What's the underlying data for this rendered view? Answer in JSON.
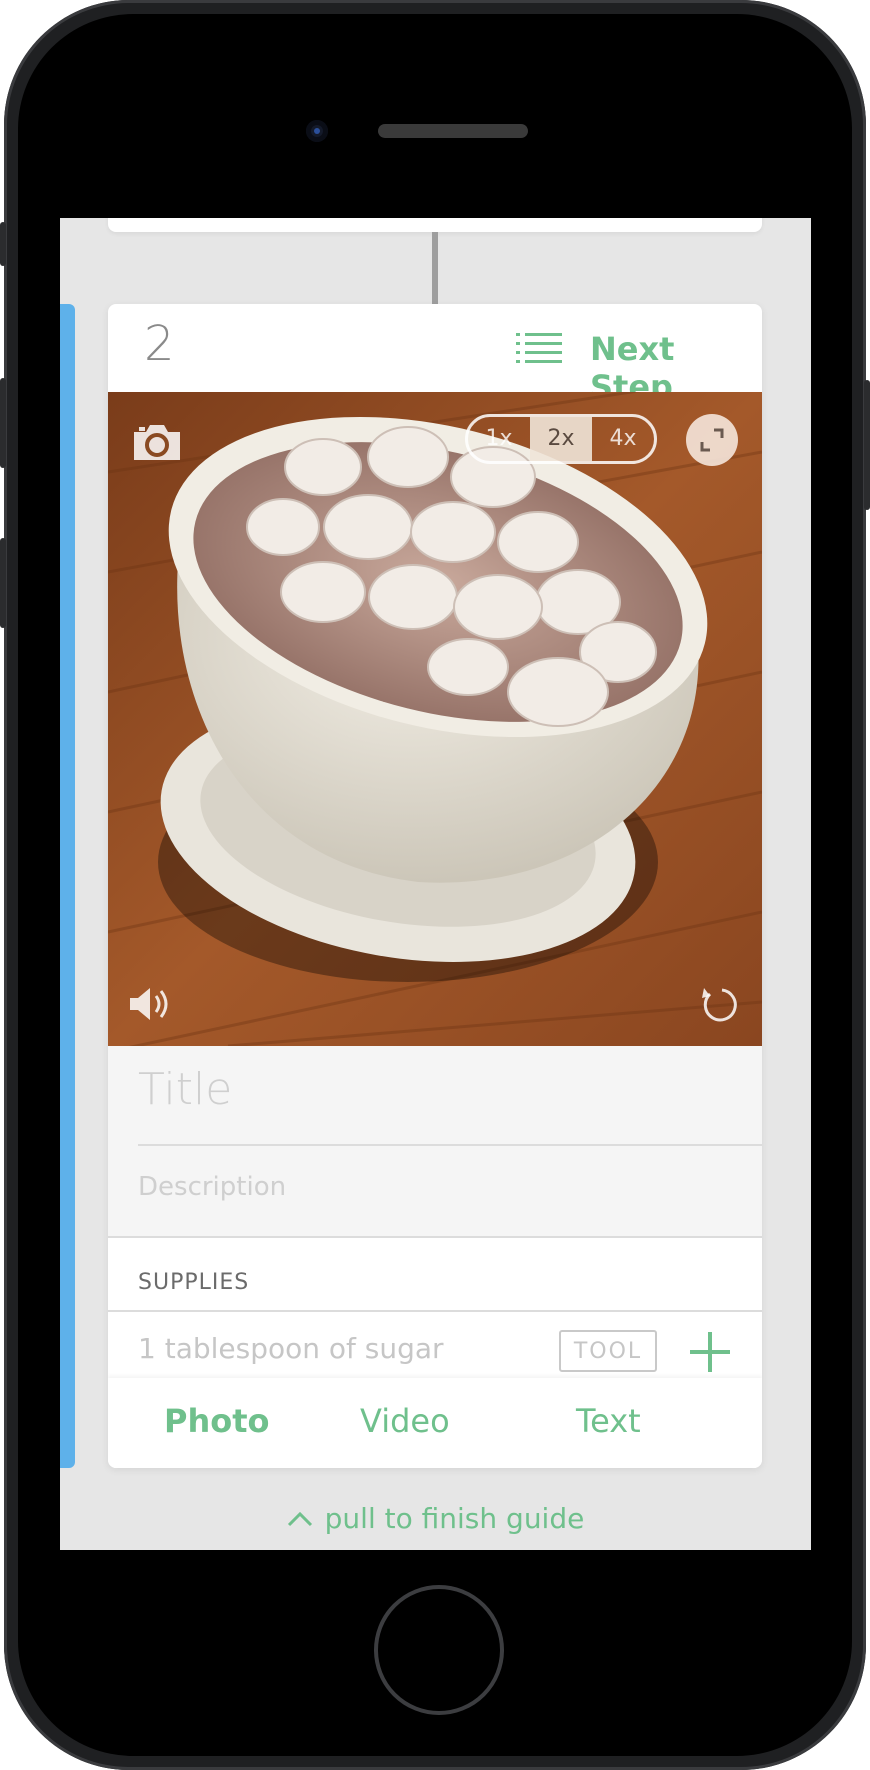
{
  "step": {
    "number": "2",
    "next_label": "Next Step"
  },
  "media": {
    "zoom_options": [
      "1x",
      "2x",
      "4x"
    ],
    "active_zoom": "2x"
  },
  "fields": {
    "title_placeholder": "Title",
    "description_placeholder": "Description"
  },
  "supplies": {
    "heading": "SUPPLIES",
    "items": [
      {
        "text": "1 tablespoon of sugar",
        "badge": "TOOL"
      }
    ]
  },
  "tabs": [
    {
      "label": "Photo",
      "active": true
    },
    {
      "label": "Video",
      "active": false
    },
    {
      "label": "Text",
      "active": false
    }
  ],
  "pull_hint": "pull to finish guide",
  "icons": {
    "list": "list-icon",
    "camera": "camera-icon",
    "expand": "expand-icon",
    "sound": "sound-icon",
    "rotate": "rotate-icon",
    "add": "plus-icon",
    "pull": "chevron-up-icon"
  },
  "colors": {
    "accent_green": "#6fc08c",
    "accent_blue": "#5eb1ea"
  }
}
